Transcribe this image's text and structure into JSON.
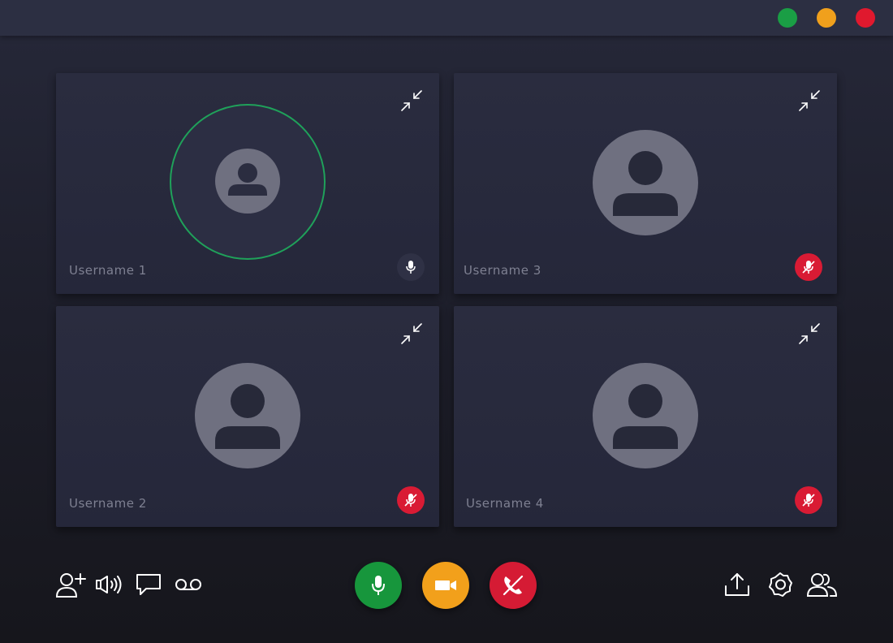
{
  "colors": {
    "window_green": "#1a9e45",
    "window_orange": "#f0a01c",
    "window_red": "#e0192e",
    "speaking_ring": "#1fa15a",
    "mute_red": "#d91b34",
    "mic_green": "#17963c",
    "camera_orange": "#f2a01b",
    "hangup_red": "#d51b34",
    "icon_white": "#ffffff"
  },
  "window_controls": [
    {
      "name": "maximize",
      "color": "#1a9e45"
    },
    {
      "name": "minimize",
      "color": "#f0a01c"
    },
    {
      "name": "close",
      "color": "#e0192e"
    }
  ],
  "participants": [
    {
      "name": "Username 1",
      "mic": "on",
      "speaking": true,
      "collapse_icon": "collapse-icon",
      "avatar_icon": "user-avatar-icon"
    },
    {
      "name": "Username 3",
      "mic": "muted",
      "speaking": false,
      "collapse_icon": "collapse-icon",
      "avatar_icon": "user-avatar-icon"
    },
    {
      "name": "Username 2",
      "mic": "muted",
      "speaking": false,
      "collapse_icon": "collapse-icon",
      "avatar_icon": "user-avatar-icon"
    },
    {
      "name": "Username 4",
      "mic": "muted",
      "speaking": false,
      "collapse_icon": "collapse-icon",
      "avatar_icon": "user-avatar-icon"
    }
  ],
  "toolbar_left": [
    "add-user-icon",
    "speaker-icon",
    "chat-icon",
    "voicemail-icon"
  ],
  "toolbar_center": [
    "microphone-icon",
    "camera-icon",
    "hang-up-icon"
  ],
  "toolbar_right": [
    "share-screen-icon",
    "settings-icon",
    "participants-icon"
  ]
}
